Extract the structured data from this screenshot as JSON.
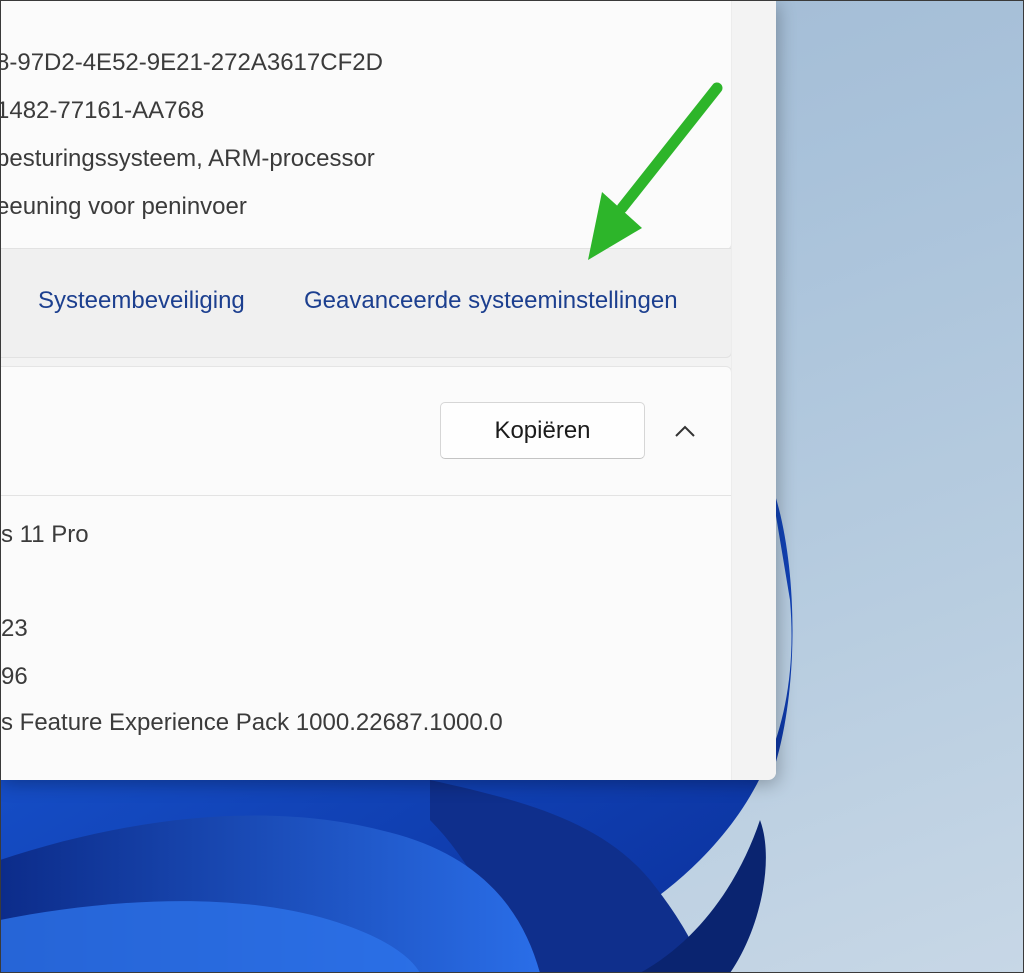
{
  "device_specs": {
    "lines": [
      "8-97D2-4E52-9E21-272A3617CF2D",
      "1482-77161-AA768",
      "besturingssysteem, ARM-processor",
      "eeuning voor peninvoer"
    ]
  },
  "related_links": {
    "system_protection": "Systeembeveiliging",
    "advanced_settings": "Geavanceerde systeeminstellingen"
  },
  "windows_specs": {
    "copy_label": "Kopiëren",
    "toggle_icon": "chevron-up-icon",
    "lines": [
      "s 11 Pro",
      "23",
      "96",
      "s Feature Experience Pack 1000.22687.1000.0"
    ]
  },
  "annotation": {
    "arrow_color": "#2db52a",
    "arrow_icon": "pointer-arrow-icon"
  },
  "colors": {
    "link": "#1c3f8f",
    "wallpaper_bloom": "#0b3fb0"
  }
}
